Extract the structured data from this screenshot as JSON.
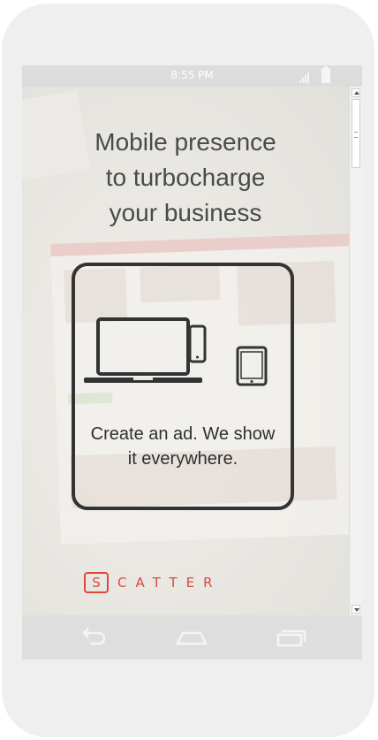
{
  "status_bar": {
    "time": "8:55 PM",
    "signal_icon": "signal-icon",
    "battery_icon": "battery-icon"
  },
  "hero": {
    "headline_lines": [
      "Mobile presence",
      "to turbocharge",
      "your business"
    ]
  },
  "card": {
    "icon": "devices-icon",
    "tagline_lines": [
      "Create an ad. We show",
      "it everywhere."
    ]
  },
  "logo": {
    "initial": "S",
    "rest": "CATTER",
    "color": "#e0473d"
  },
  "nav_bar": {
    "back_icon": "back-icon",
    "home_icon": "home-icon",
    "recents_icon": "recents-icon"
  },
  "colors": {
    "brand": "#e0473d",
    "text": "#4a4a4a",
    "frame": "#333333"
  }
}
